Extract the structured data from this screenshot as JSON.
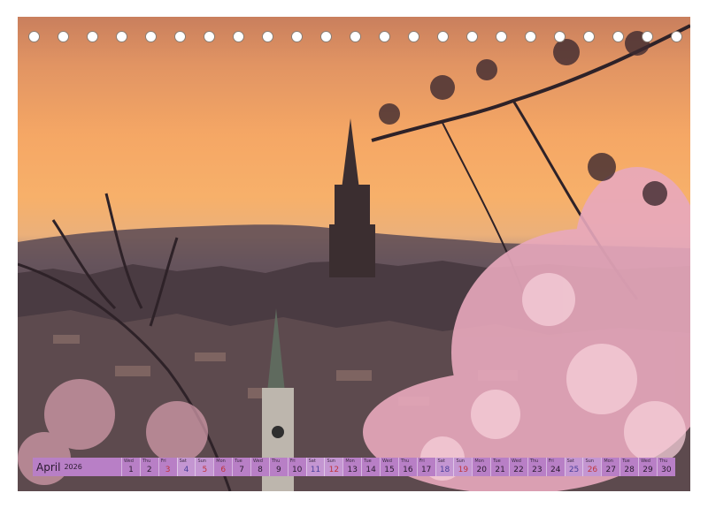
{
  "calendar": {
    "month": "April",
    "year": "2026",
    "days": [
      {
        "n": "1",
        "wd": "Wed",
        "kind": "week"
      },
      {
        "n": "2",
        "wd": "Thu",
        "kind": "week"
      },
      {
        "n": "3",
        "wd": "Fri",
        "kind": "hol"
      },
      {
        "n": "4",
        "wd": "Sat",
        "kind": "sat"
      },
      {
        "n": "5",
        "wd": "Sun",
        "kind": "sun"
      },
      {
        "n": "6",
        "wd": "Mon",
        "kind": "hol"
      },
      {
        "n": "7",
        "wd": "Tue",
        "kind": "week"
      },
      {
        "n": "8",
        "wd": "Wed",
        "kind": "week"
      },
      {
        "n": "9",
        "wd": "Thu",
        "kind": "week"
      },
      {
        "n": "10",
        "wd": "Fri",
        "kind": "week"
      },
      {
        "n": "11",
        "wd": "Sat",
        "kind": "sat"
      },
      {
        "n": "12",
        "wd": "Sun",
        "kind": "sun"
      },
      {
        "n": "13",
        "wd": "Mon",
        "kind": "week"
      },
      {
        "n": "14",
        "wd": "Tue",
        "kind": "week"
      },
      {
        "n": "15",
        "wd": "Wed",
        "kind": "week"
      },
      {
        "n": "16",
        "wd": "Thu",
        "kind": "week"
      },
      {
        "n": "17",
        "wd": "Fri",
        "kind": "week"
      },
      {
        "n": "18",
        "wd": "Sat",
        "kind": "sat"
      },
      {
        "n": "19",
        "wd": "Sun",
        "kind": "sun"
      },
      {
        "n": "20",
        "wd": "Mon",
        "kind": "week"
      },
      {
        "n": "21",
        "wd": "Tue",
        "kind": "week"
      },
      {
        "n": "22",
        "wd": "Wed",
        "kind": "week"
      },
      {
        "n": "23",
        "wd": "Thu",
        "kind": "week"
      },
      {
        "n": "24",
        "wd": "Fri",
        "kind": "week"
      },
      {
        "n": "25",
        "wd": "Sat",
        "kind": "sat"
      },
      {
        "n": "26",
        "wd": "Sun",
        "kind": "sun"
      },
      {
        "n": "27",
        "wd": "Mon",
        "kind": "week"
      },
      {
        "n": "28",
        "wd": "Tue",
        "kind": "week"
      },
      {
        "n": "29",
        "wd": "Wed",
        "kind": "week"
      },
      {
        "n": "30",
        "wd": "Thu",
        "kind": "week"
      }
    ]
  },
  "binding": {
    "hole_count": 23
  },
  "colors": {
    "strip": "#b87fc6",
    "weekend": "#c496d2",
    "holiday_text": "#c0343c",
    "saturday_text": "#4a3f9a",
    "sky_top": "#c97f5d",
    "sky_glow": "#f7b06a",
    "blossom": "#e8a9bd"
  }
}
